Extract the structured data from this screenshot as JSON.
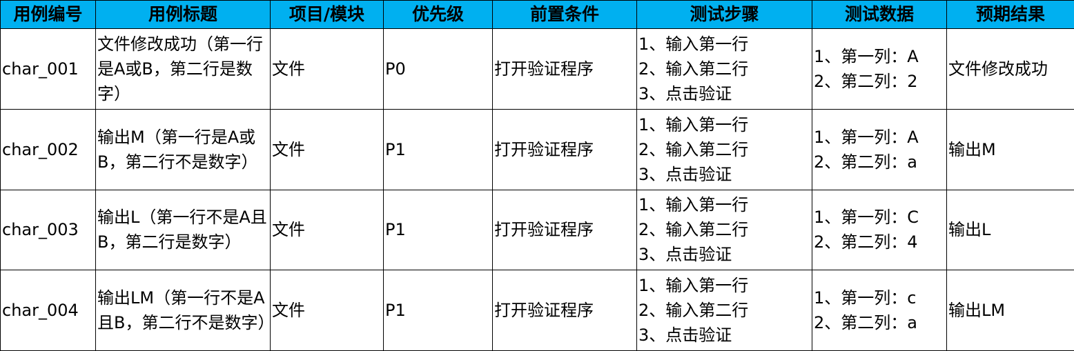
{
  "header_fill": "#00B0F0",
  "headers": [
    "用例编号",
    "用例标题",
    "项目/模块",
    "优先级",
    "前置条件",
    "测试步骤",
    "测试数据",
    "预期结果"
  ],
  "rows": [
    {
      "id": "char_001",
      "title": "文件修改成功（第一行是A或B，第二行是数字）",
      "module": "文件",
      "priority": "P0",
      "precondition": "打开验证程序",
      "steps": [
        "1、输入第一行",
        "2、输入第二行",
        "3、点击验证"
      ],
      "data": [
        "1、第一列：A",
        "2、第二列：2"
      ],
      "expected": "文件修改成功"
    },
    {
      "id": "char_002",
      "title": "输出M（第一行是A或B，第二行不是数字）",
      "module": "文件",
      "priority": "P1",
      "precondition": "打开验证程序",
      "steps": [
        "1、输入第一行",
        "2、输入第二行",
        "3、点击验证"
      ],
      "data": [
        "1、第一列：A",
        "2、第二列：a"
      ],
      "expected": "输出M"
    },
    {
      "id": "char_003",
      "title": "输出L（第一行不是A且B，第二行是数字）",
      "module": "文件",
      "priority": "P1",
      "precondition": "打开验证程序",
      "steps": [
        "1、输入第一行",
        "2、输入第二行",
        "3、点击验证"
      ],
      "data": [
        "1、第一列：C",
        "2、第二列：4"
      ],
      "expected": "输出L"
    },
    {
      "id": "char_004",
      "title": "输出LM（第一行不是A且B，第二行不是数字）",
      "module": "文件",
      "priority": "P1",
      "precondition": "打开验证程序",
      "steps": [
        "1、输入第一行",
        "2、输入第二行",
        "3、点击验证"
      ],
      "data": [
        "1、第一列：c",
        "2、第二列：a"
      ],
      "expected": "输出LM"
    }
  ]
}
